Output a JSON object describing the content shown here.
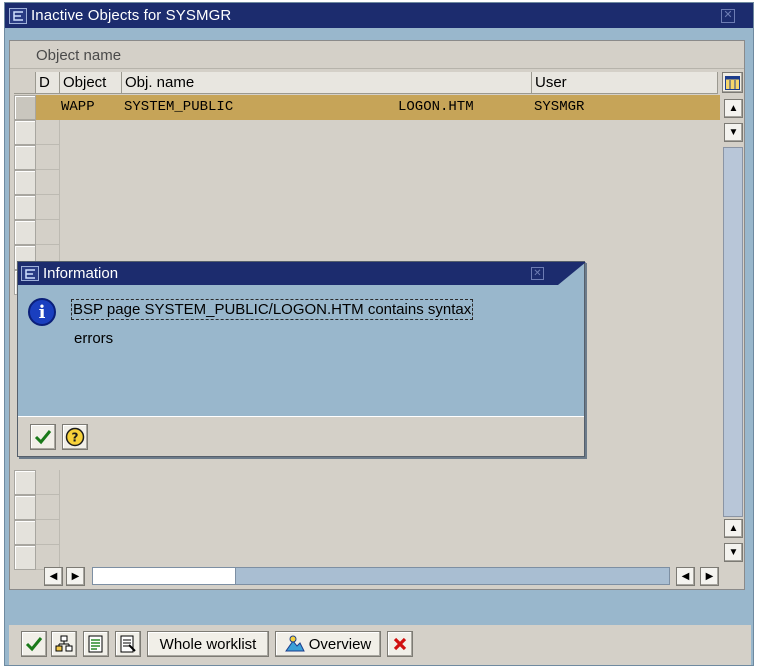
{
  "window": {
    "title": "Inactive Objects for SYSMGR",
    "close_glyph": "✕"
  },
  "list": {
    "section_label": "Object name",
    "columns": [
      "D",
      "Object",
      "Obj. name",
      "User"
    ],
    "rows": [
      {
        "d": "",
        "object": "WAPP",
        "obj_name": "SYSTEM_PUBLIC",
        "page": "LOGON.HTM",
        "user": "SYSMGR"
      }
    ],
    "layout_icon": "column-layout-icon"
  },
  "popup": {
    "title": "Information",
    "message_line1": "BSP page SYSTEM_PUBLIC/LOGON.HTM contains syntax",
    "message_line2": "errors",
    "icon": "info-icon",
    "close_glyph": "✕",
    "buttons": [
      {
        "icon": "check-icon"
      },
      {
        "icon": "help-icon"
      }
    ]
  },
  "toolbar": {
    "whole_worklist": "Whole worklist",
    "overview": "Overview",
    "icons": [
      "check-icon",
      "hierarchy-icon",
      "activate-list-icon",
      "detail-list-icon",
      "overview-icon",
      "cancel-icon"
    ]
  },
  "colors": {
    "selected_row": "#c6a458",
    "titlebar": "#1c2c6e",
    "background": "#99b7cc"
  }
}
